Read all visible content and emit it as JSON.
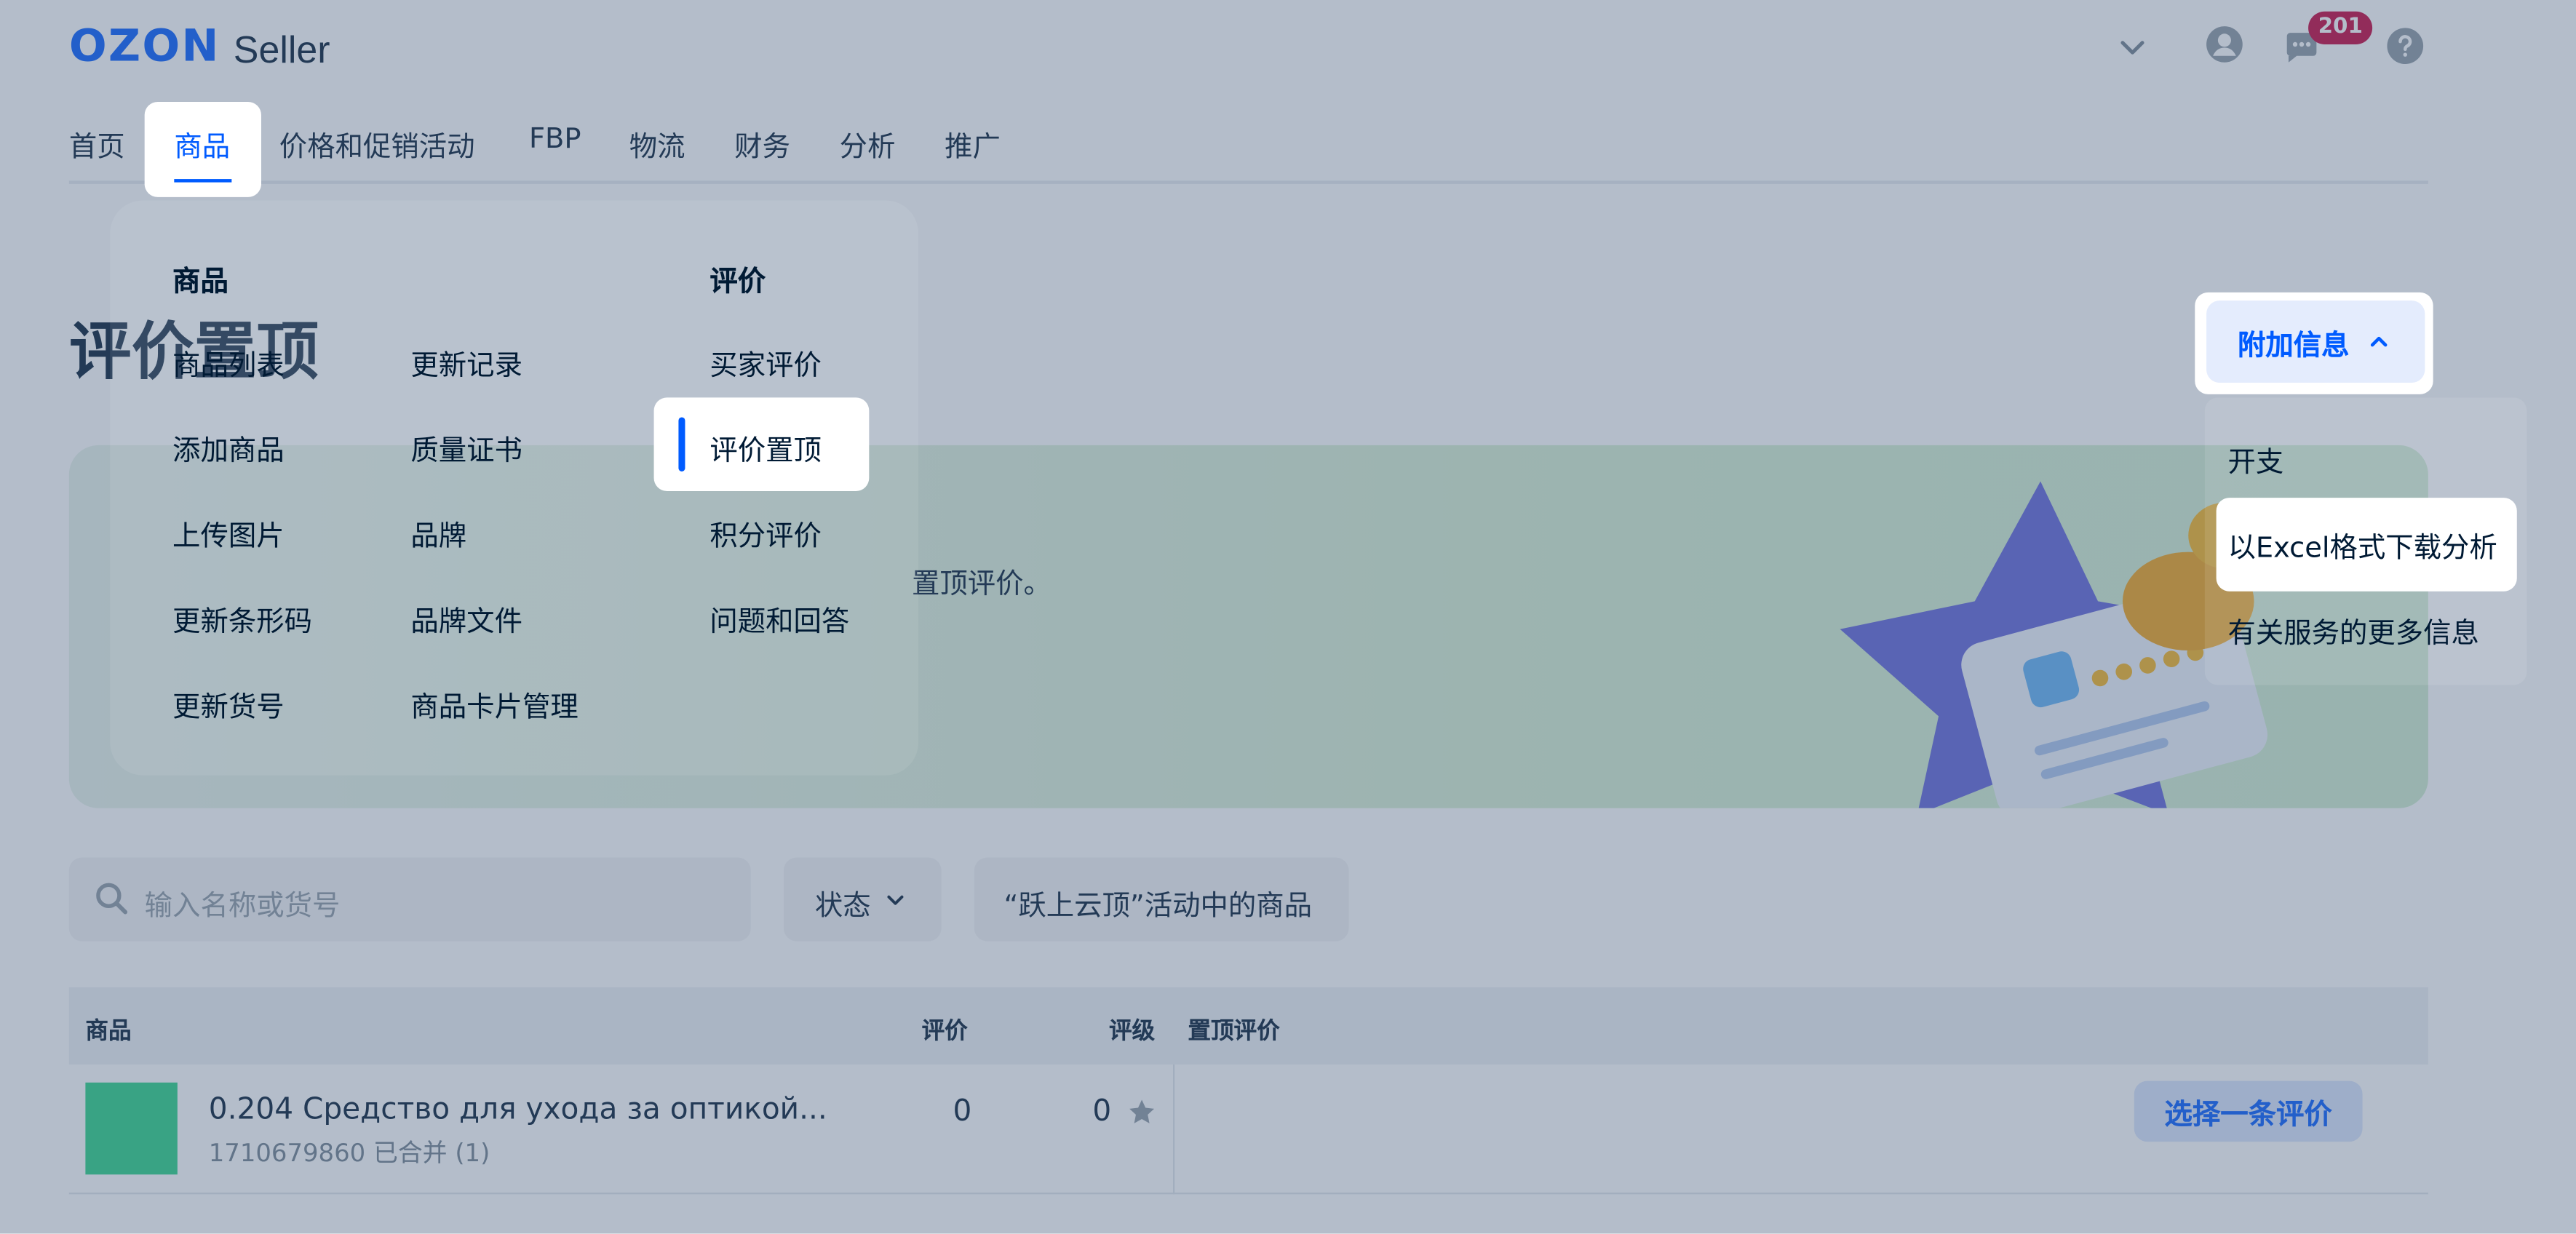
{
  "header": {
    "logo_ozon": "OZON",
    "logo_seller": "Seller",
    "notification_count": "201",
    "icons": [
      "chevron-down-icon",
      "account-icon",
      "chat-icon",
      "help-icon"
    ]
  },
  "nav": {
    "items": [
      "首页",
      "商品",
      "价格和促销活动",
      "FBP",
      "物流",
      "财务",
      "分析",
      "推广"
    ],
    "active": "商品"
  },
  "page": {
    "title": "评价置顶",
    "banner_text": "置顶评价。"
  },
  "products_menu": {
    "col1_heading": "商品",
    "col1": [
      "商品列表",
      "添加商品",
      "上传图片",
      "更新条形码",
      "更新货号"
    ],
    "col2": [
      "更新记录",
      "质量证书",
      "品牌",
      "品牌文件",
      "商品卡片管理"
    ],
    "col3_heading": "评价",
    "col3": [
      "买家评价",
      "评价置顶",
      "积分评价",
      "问题和回答"
    ],
    "active_item": "评价置顶"
  },
  "extra_info": {
    "button_label": "附加信息",
    "items": [
      "开支",
      "以Excel格式下载分析",
      "有关服务的更多信息"
    ],
    "highlighted": "以Excel格式下载分析"
  },
  "filters": {
    "search_placeholder": "输入名称或货号",
    "status_label": "状态",
    "promo_label": "“跃上云顶”活动中的商品"
  },
  "table": {
    "headers": {
      "product": "商品",
      "reviews": "评价",
      "rating": "评级",
      "pinned": "置顶评价"
    },
    "rows": [
      {
        "name": "0.204 Средство для ухода за оптикой...",
        "sub": "1710679860 已合并 (1)",
        "reviews": "0",
        "rating": "0",
        "action": "选择一条评价"
      }
    ]
  },
  "colors": {
    "brand": "#005bff",
    "badge": "#c4003b",
    "overlay": "#516783"
  }
}
